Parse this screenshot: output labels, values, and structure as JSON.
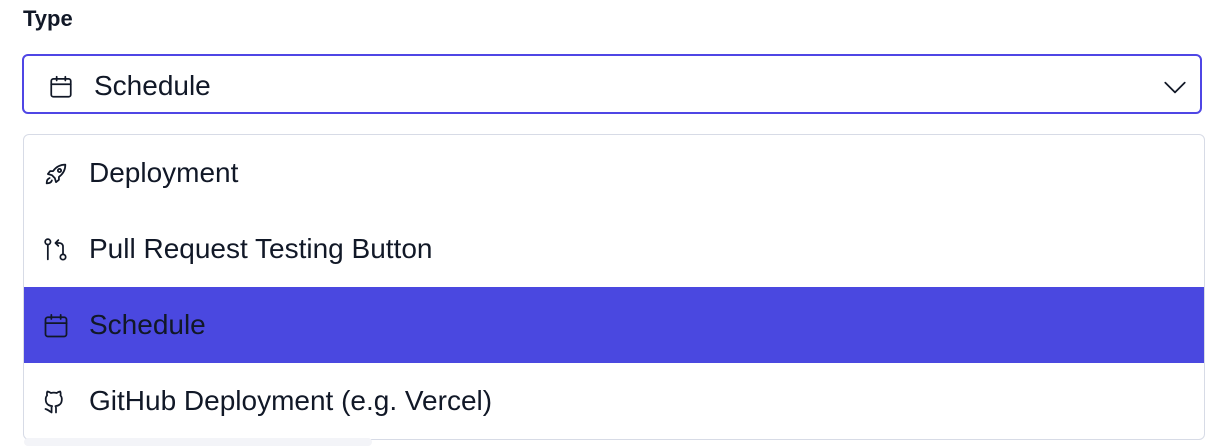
{
  "field": {
    "label": "Type",
    "selected_value": "Schedule",
    "selected_icon": "calendar-icon",
    "toggle_icon": "chevron-down-icon",
    "accent_color": "#4f46e5"
  },
  "menu": {
    "options": [
      {
        "label": "Deployment",
        "icon": "rocket-icon",
        "selected": false
      },
      {
        "label": "Pull Request Testing Button",
        "icon": "git-pull-request-icon",
        "selected": false
      },
      {
        "label": "Schedule",
        "icon": "calendar-icon",
        "selected": true
      },
      {
        "label": "GitHub Deployment (e.g. Vercel)",
        "icon": "github-icon",
        "selected": false
      }
    ],
    "selected_bg": "#4a48e0"
  }
}
